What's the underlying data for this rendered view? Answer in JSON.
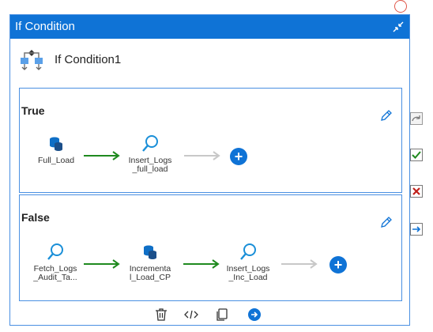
{
  "dialog": {
    "title": "If Condition",
    "activity_name": "If Condition1"
  },
  "branches": {
    "true": {
      "label": "True",
      "activities": [
        {
          "name": "Full_Load",
          "icon": "database-icon"
        },
        {
          "name": "Insert_Logs\n_full_load",
          "icon": "lookup-icon"
        }
      ]
    },
    "false": {
      "label": "False",
      "activities": [
        {
          "name": "Fetch_Logs\n_Audit_Ta...",
          "icon": "lookup-icon"
        },
        {
          "name": "Incrementa\nl_Load_CP",
          "icon": "database-icon"
        },
        {
          "name": "Insert_Logs\n_Inc_Load",
          "icon": "lookup-icon"
        }
      ]
    }
  },
  "colors": {
    "header": "#0f73d6",
    "border": "#4a90e2",
    "success_arrow": "#1f8a1f",
    "default_arrow": "#c8c8c8",
    "plus": "#0f73d6"
  },
  "toolbar": [
    "delete-icon",
    "code-icon",
    "copy-icon",
    "go-icon"
  ],
  "side_panel": [
    "redo-icon",
    "success-check-icon",
    "failure-x-icon",
    "completion-arrow-icon"
  ]
}
